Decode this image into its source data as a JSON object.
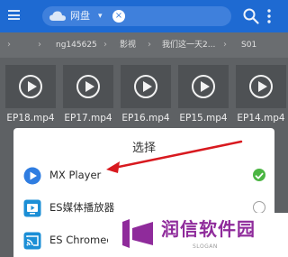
{
  "topbar": {
    "title": "网盘",
    "caret": "▾",
    "close": "×",
    "menu_icon": "menu-icon",
    "search_icon": "search-icon",
    "more_icon": "more-vert-icon",
    "bg_color": "#1e6ad2"
  },
  "path": {
    "items": [
      "ng145625",
      "影视",
      "我们这一天2...",
      "S01"
    ]
  },
  "videos": [
    {
      "name": "EP18.mp4"
    },
    {
      "name": "EP17.mp4"
    },
    {
      "name": "EP16.mp4"
    },
    {
      "name": "EP15.mp4"
    },
    {
      "name": "EP14.mp4"
    }
  ],
  "dialog": {
    "title": "选择",
    "options": [
      {
        "label": "MX Player",
        "icon": "mx-player-icon",
        "selected": true
      },
      {
        "label": "ES媒体播放器",
        "icon": "es-media-player-icon",
        "selected": false
      },
      {
        "label": "ES Chromecast",
        "icon": "cast-icon",
        "selected": false
      }
    ],
    "selected_color": "#4bb543"
  },
  "annotation": {
    "arrow_color": "#d8191f"
  },
  "watermark": {
    "brand": "润信软件园",
    "slogan": "SLOGAN",
    "color": "#8f2b9b"
  }
}
